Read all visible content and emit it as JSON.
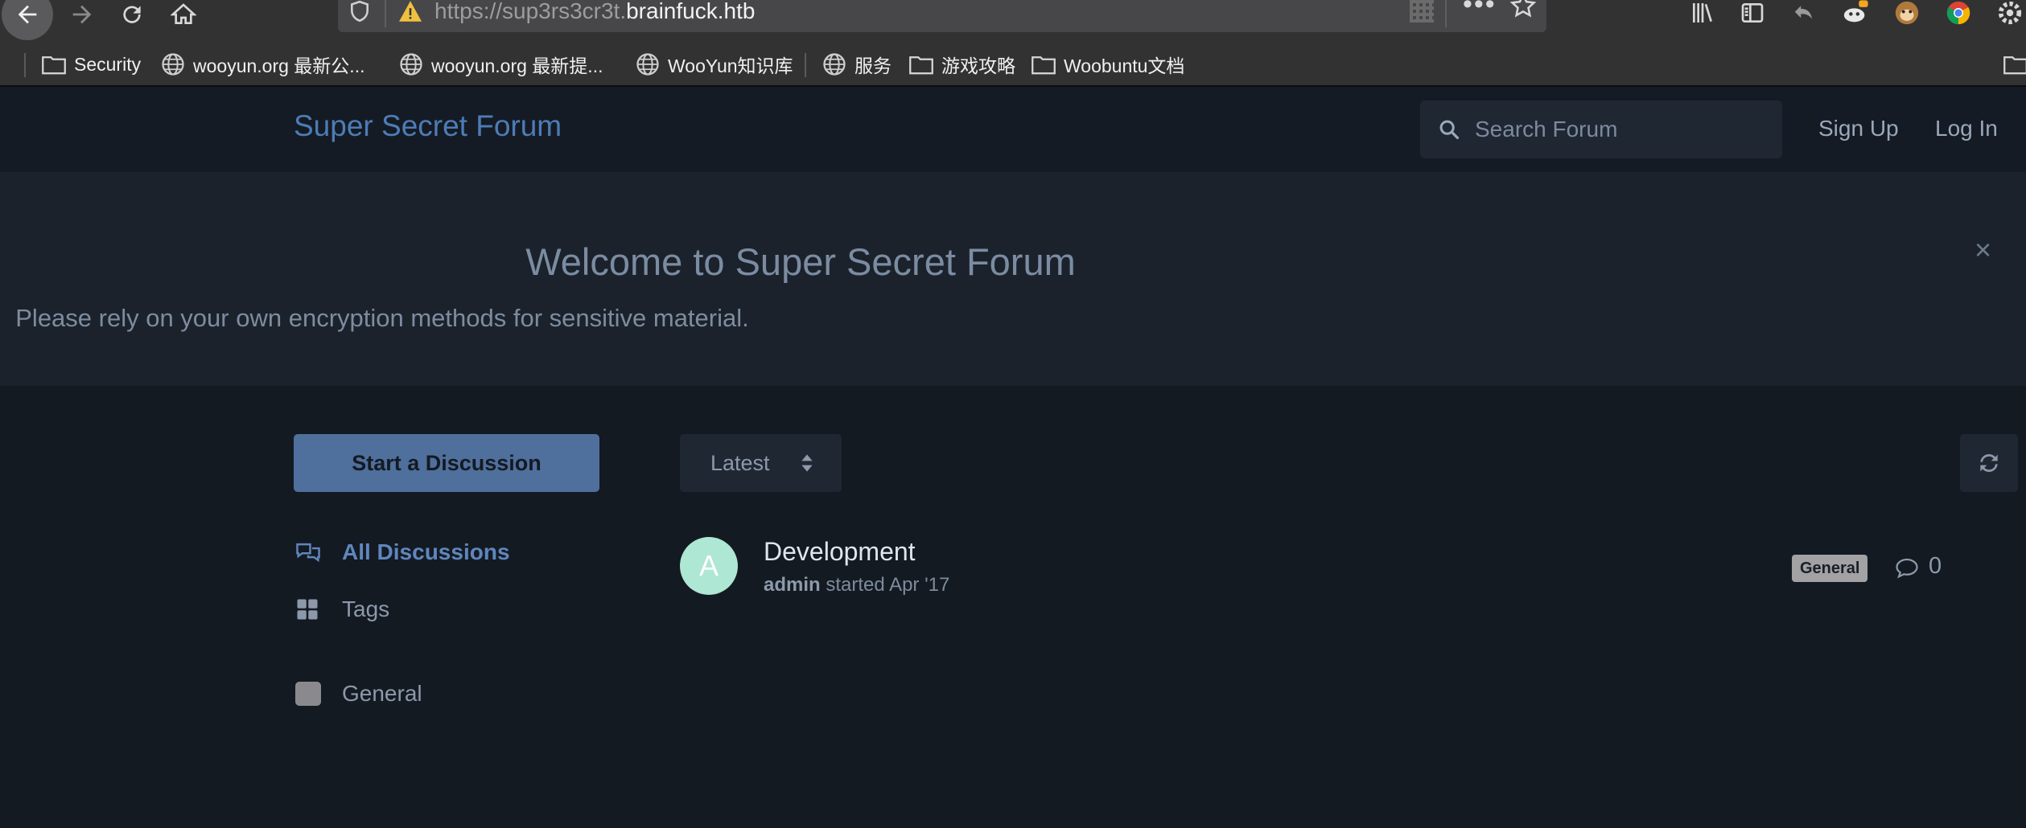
{
  "browser": {
    "url_prefix": "https://sup3rs3cr3t.",
    "url_domain": "brainfuck.htb",
    "bookmarks": [
      {
        "label": "Security",
        "icon": "folder-icon"
      },
      {
        "label": "wooyun.org 最新公...",
        "icon": "globe-icon"
      },
      {
        "label": "wooyun.org 最新提...",
        "icon": "globe-icon"
      },
      {
        "label": "WooYun知识库",
        "icon": "globe-icon"
      },
      {
        "label": "服务",
        "icon": "globe-icon"
      },
      {
        "label": "游戏攻略",
        "icon": "folder-icon"
      },
      {
        "label": "Woobuntu文档",
        "icon": "folder-icon"
      }
    ]
  },
  "header": {
    "site_title": "Super Secret Forum",
    "search_placeholder": "Search Forum",
    "signup_label": "Sign Up",
    "login_label": "Log In"
  },
  "hero": {
    "title": "Welcome to Super Secret Forum",
    "subtitle": "Please rely on your own encryption methods for sensitive material.",
    "close_glyph": "×"
  },
  "sidebar": {
    "start_button_label": "Start a Discussion",
    "nav_all_label": "All Discussions",
    "nav_tags_label": "Tags",
    "tag_general_label": "General"
  },
  "toolbar": {
    "sort_label": "Latest"
  },
  "discussions": [
    {
      "title": "Development",
      "avatar_letter": "A",
      "author": "admin",
      "started": "started Apr '17",
      "tag": "General",
      "replies": "0"
    }
  ],
  "colors": {
    "background": "#141a22",
    "accent": "#4d7cb7",
    "start_button": "#4f6f9c",
    "avatar": "#aee7d3"
  }
}
